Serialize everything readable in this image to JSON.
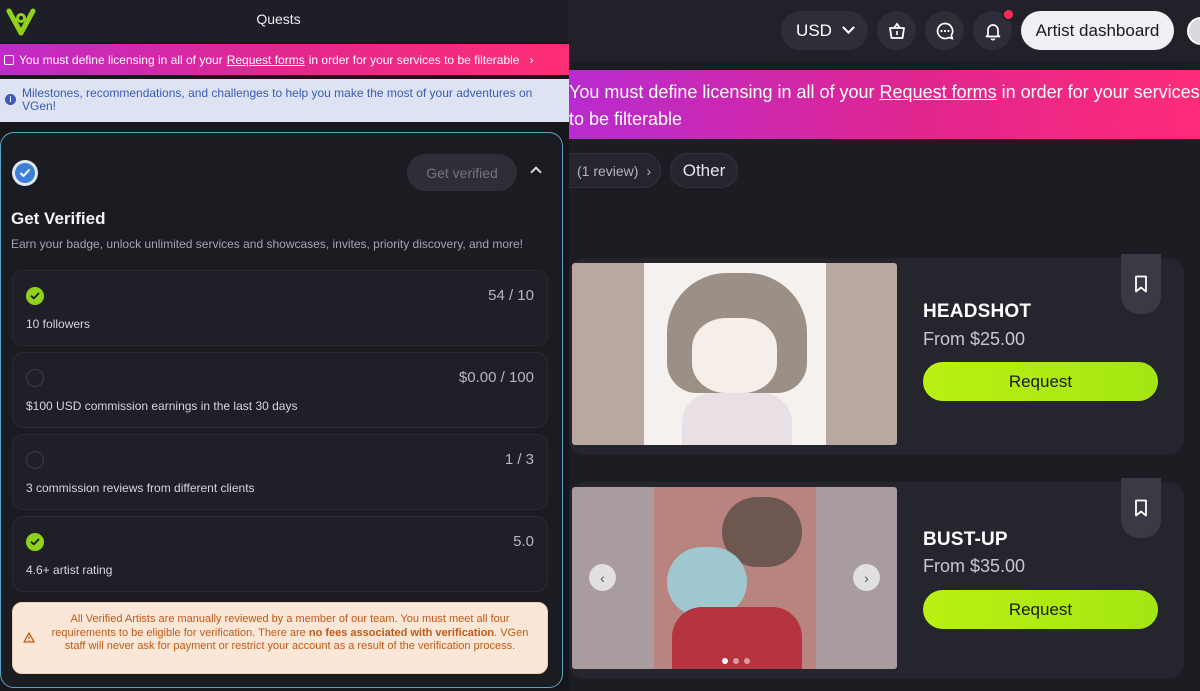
{
  "header": {
    "currency": "USD",
    "artist_dashboard": "Artist dashboard"
  },
  "background_banner": {
    "text_before": "You must define licensing in all of your",
    "link": "Request forms",
    "text_after": "in order for your services to be filterable"
  },
  "filters": {
    "reviews_chip": "(1 review)",
    "other_chip": "Other"
  },
  "services": [
    {
      "title": "HEADSHOT",
      "price": "From $25.00",
      "button": "Request"
    },
    {
      "title": "BUST-UP",
      "price": "From $35.00",
      "button": "Request"
    }
  ],
  "quests": {
    "title": "Quests",
    "banner": {
      "text_before": "You must define licensing in all of your",
      "link": "Request forms",
      "text_after": "in order for your services to be filterable"
    },
    "info": "Milestones, recommendations, and challenges to help you make the most of your adventures on VGen!",
    "verify": {
      "button": "Get verified",
      "title": "Get Verified",
      "subtitle": "Earn your badge, unlock unlimited services and showcases, invites, priority discovery, and more!",
      "requirements": [
        {
          "label": "10 followers",
          "value": "54 / 10",
          "done": true
        },
        {
          "label": "$100 USD commission earnings in the last 30 days",
          "value": "$0.00 / 100",
          "done": false
        },
        {
          "label": "3 commission reviews from different clients",
          "value": "1 / 3",
          "done": false
        },
        {
          "label": "4.6+ artist rating",
          "value": "5.0",
          "done": true
        }
      ],
      "warning": {
        "text_before": "All Verified Artists are manually reviewed by a member of our team. You must meet all four requirements to be eligible for verification. There are",
        "bold": "no fees associated with verification",
        "text_after": ". VGen staff will never ask for payment or restrict your account as a result of the verification process."
      }
    }
  },
  "colors": {
    "accent_green": "#a4e612",
    "banner_pink": "#e1278e",
    "banner_purple": "#b82bd0",
    "info_blue": "#3a5bb7",
    "warning_orange": "#c25a16",
    "notification_red": "#ff2d55"
  }
}
